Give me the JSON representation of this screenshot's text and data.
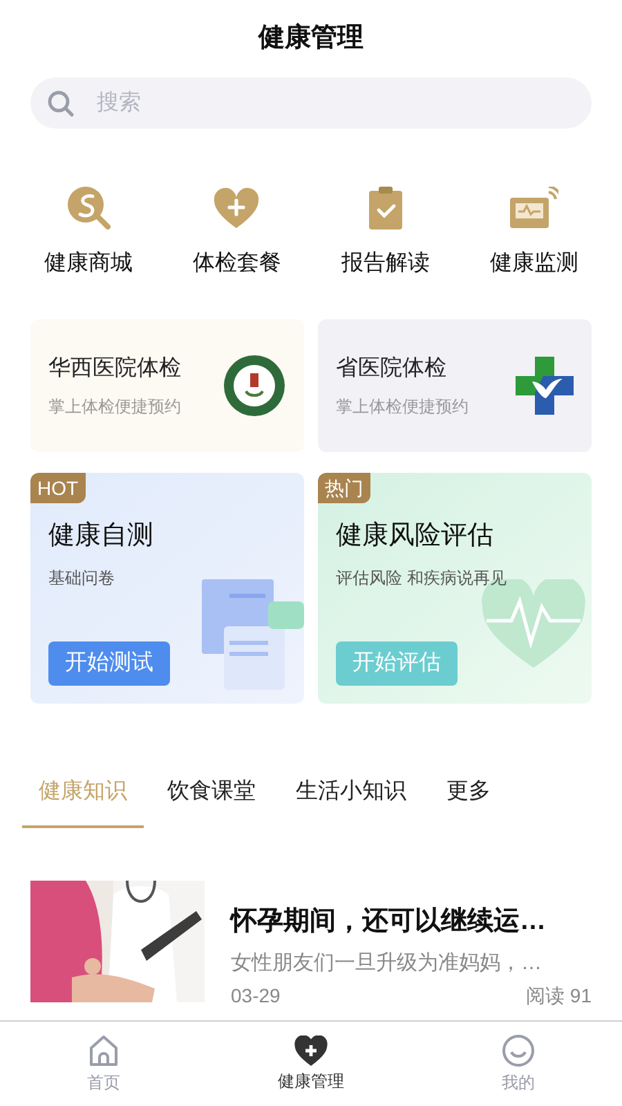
{
  "header": {
    "title": "健康管理"
  },
  "search": {
    "placeholder": "搜索"
  },
  "shortcuts": [
    {
      "kind": "mall",
      "label": "健康商城"
    },
    {
      "kind": "package",
      "label": "体检套餐"
    },
    {
      "kind": "report",
      "label": "报告解读"
    },
    {
      "kind": "monitor",
      "label": "健康监测"
    }
  ],
  "hospitals": [
    {
      "kind": "huaxi",
      "name": "华西医院体检",
      "subtitle": "掌上体检便捷预约"
    },
    {
      "kind": "provincial",
      "name": "省医院体检",
      "subtitle": "掌上体检便捷预约"
    }
  ],
  "features": [
    {
      "kind": "selftest",
      "badge": "HOT",
      "title": "健康自测",
      "subtitle": "基础问卷",
      "button": "开始测试"
    },
    {
      "kind": "risk",
      "badge": "热门",
      "title": "健康风险评估",
      "subtitle": "评估风险 和疾病说再见",
      "button": "开始评估"
    }
  ],
  "tabs": [
    {
      "label": "健康知识",
      "selected": true
    },
    {
      "label": "饮食课堂",
      "selected": false
    },
    {
      "label": "生活小知识",
      "selected": false
    },
    {
      "label": "更多",
      "selected": false
    }
  ],
  "articles": [
    {
      "title": "怀孕期间，还可以继续运…",
      "summary": "女性朋友们一旦升级为准妈妈，…",
      "date": "03-29",
      "reads": "阅读 91"
    }
  ],
  "tab_bar": [
    {
      "kind": "home",
      "label": "首页",
      "selected": false
    },
    {
      "kind": "health",
      "label": "健康管理",
      "selected": true
    },
    {
      "kind": "me",
      "label": "我的",
      "selected": false
    }
  ]
}
